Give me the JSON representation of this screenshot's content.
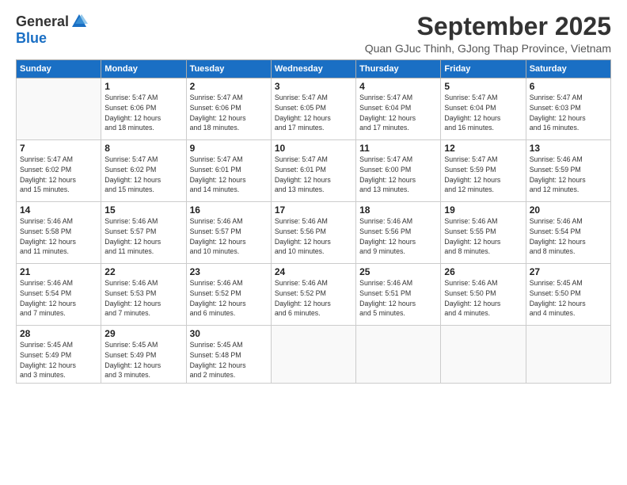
{
  "logo": {
    "general": "General",
    "blue": "Blue"
  },
  "title": "September 2025",
  "subtitle": "Quan GJuc Thinh, GJong Thap Province, Vietnam",
  "days_of_week": [
    "Sunday",
    "Monday",
    "Tuesday",
    "Wednesday",
    "Thursday",
    "Friday",
    "Saturday"
  ],
  "weeks": [
    [
      {
        "day": "",
        "info": ""
      },
      {
        "day": "1",
        "info": "Sunrise: 5:47 AM\nSunset: 6:06 PM\nDaylight: 12 hours\nand 18 minutes."
      },
      {
        "day": "2",
        "info": "Sunrise: 5:47 AM\nSunset: 6:06 PM\nDaylight: 12 hours\nand 18 minutes."
      },
      {
        "day": "3",
        "info": "Sunrise: 5:47 AM\nSunset: 6:05 PM\nDaylight: 12 hours\nand 17 minutes."
      },
      {
        "day": "4",
        "info": "Sunrise: 5:47 AM\nSunset: 6:04 PM\nDaylight: 12 hours\nand 17 minutes."
      },
      {
        "day": "5",
        "info": "Sunrise: 5:47 AM\nSunset: 6:04 PM\nDaylight: 12 hours\nand 16 minutes."
      },
      {
        "day": "6",
        "info": "Sunrise: 5:47 AM\nSunset: 6:03 PM\nDaylight: 12 hours\nand 16 minutes."
      }
    ],
    [
      {
        "day": "7",
        "info": "Sunrise: 5:47 AM\nSunset: 6:02 PM\nDaylight: 12 hours\nand 15 minutes."
      },
      {
        "day": "8",
        "info": "Sunrise: 5:47 AM\nSunset: 6:02 PM\nDaylight: 12 hours\nand 15 minutes."
      },
      {
        "day": "9",
        "info": "Sunrise: 5:47 AM\nSunset: 6:01 PM\nDaylight: 12 hours\nand 14 minutes."
      },
      {
        "day": "10",
        "info": "Sunrise: 5:47 AM\nSunset: 6:01 PM\nDaylight: 12 hours\nand 13 minutes."
      },
      {
        "day": "11",
        "info": "Sunrise: 5:47 AM\nSunset: 6:00 PM\nDaylight: 12 hours\nand 13 minutes."
      },
      {
        "day": "12",
        "info": "Sunrise: 5:47 AM\nSunset: 5:59 PM\nDaylight: 12 hours\nand 12 minutes."
      },
      {
        "day": "13",
        "info": "Sunrise: 5:46 AM\nSunset: 5:59 PM\nDaylight: 12 hours\nand 12 minutes."
      }
    ],
    [
      {
        "day": "14",
        "info": "Sunrise: 5:46 AM\nSunset: 5:58 PM\nDaylight: 12 hours\nand 11 minutes."
      },
      {
        "day": "15",
        "info": "Sunrise: 5:46 AM\nSunset: 5:57 PM\nDaylight: 12 hours\nand 11 minutes."
      },
      {
        "day": "16",
        "info": "Sunrise: 5:46 AM\nSunset: 5:57 PM\nDaylight: 12 hours\nand 10 minutes."
      },
      {
        "day": "17",
        "info": "Sunrise: 5:46 AM\nSunset: 5:56 PM\nDaylight: 12 hours\nand 10 minutes."
      },
      {
        "day": "18",
        "info": "Sunrise: 5:46 AM\nSunset: 5:56 PM\nDaylight: 12 hours\nand 9 minutes."
      },
      {
        "day": "19",
        "info": "Sunrise: 5:46 AM\nSunset: 5:55 PM\nDaylight: 12 hours\nand 8 minutes."
      },
      {
        "day": "20",
        "info": "Sunrise: 5:46 AM\nSunset: 5:54 PM\nDaylight: 12 hours\nand 8 minutes."
      }
    ],
    [
      {
        "day": "21",
        "info": "Sunrise: 5:46 AM\nSunset: 5:54 PM\nDaylight: 12 hours\nand 7 minutes."
      },
      {
        "day": "22",
        "info": "Sunrise: 5:46 AM\nSunset: 5:53 PM\nDaylight: 12 hours\nand 7 minutes."
      },
      {
        "day": "23",
        "info": "Sunrise: 5:46 AM\nSunset: 5:52 PM\nDaylight: 12 hours\nand 6 minutes."
      },
      {
        "day": "24",
        "info": "Sunrise: 5:46 AM\nSunset: 5:52 PM\nDaylight: 12 hours\nand 6 minutes."
      },
      {
        "day": "25",
        "info": "Sunrise: 5:46 AM\nSunset: 5:51 PM\nDaylight: 12 hours\nand 5 minutes."
      },
      {
        "day": "26",
        "info": "Sunrise: 5:46 AM\nSunset: 5:50 PM\nDaylight: 12 hours\nand 4 minutes."
      },
      {
        "day": "27",
        "info": "Sunrise: 5:45 AM\nSunset: 5:50 PM\nDaylight: 12 hours\nand 4 minutes."
      }
    ],
    [
      {
        "day": "28",
        "info": "Sunrise: 5:45 AM\nSunset: 5:49 PM\nDaylight: 12 hours\nand 3 minutes."
      },
      {
        "day": "29",
        "info": "Sunrise: 5:45 AM\nSunset: 5:49 PM\nDaylight: 12 hours\nand 3 minutes."
      },
      {
        "day": "30",
        "info": "Sunrise: 5:45 AM\nSunset: 5:48 PM\nDaylight: 12 hours\nand 2 minutes."
      },
      {
        "day": "",
        "info": ""
      },
      {
        "day": "",
        "info": ""
      },
      {
        "day": "",
        "info": ""
      },
      {
        "day": "",
        "info": ""
      }
    ]
  ]
}
